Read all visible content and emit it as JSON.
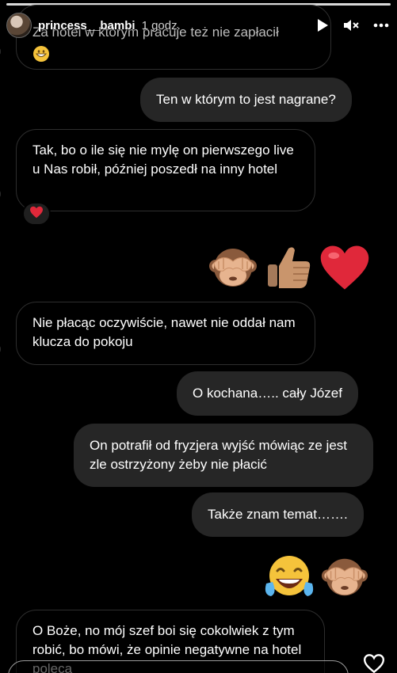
{
  "story": {
    "username": "princess__bambi",
    "time": "1 godz."
  },
  "messages": {
    "m1": "Za hotel w którym pracuje też nie zapłacił",
    "m2": "Ten w którym to jest nagrane?",
    "m3": "Tak, bo o ile się nie mylę on pierwszego live u Nas robił, później poszedł na inny hotel",
    "m4": "Nie płacąc oczywiście, nawet nie oddał nam klucza do pokoju",
    "m5": "O kochana….. cały Józef",
    "m6": "On potrafił od fryzjera wyjść mówiąc ze jest zle ostrzyżony żeby nie płacić",
    "m7": "Także znam temat…….",
    "m8": "O Boże, no mój szef boi się cokolwiek z tym robić, bo mówi, że opinie negatywne na hotel poleca"
  },
  "reactions": {
    "m3": "heart"
  },
  "emoji_messages": {
    "row1": [
      "see-no-evil-monkey",
      "thumbs-up",
      "red-heart"
    ],
    "row2": [
      "tears-of-joy",
      "see-no-evil-monkey"
    ]
  },
  "colors": {
    "incoming_bg": "#000000",
    "incoming_border": "#2e2e2e",
    "outgoing_bg": "#262626",
    "heart": "#e0283a"
  }
}
